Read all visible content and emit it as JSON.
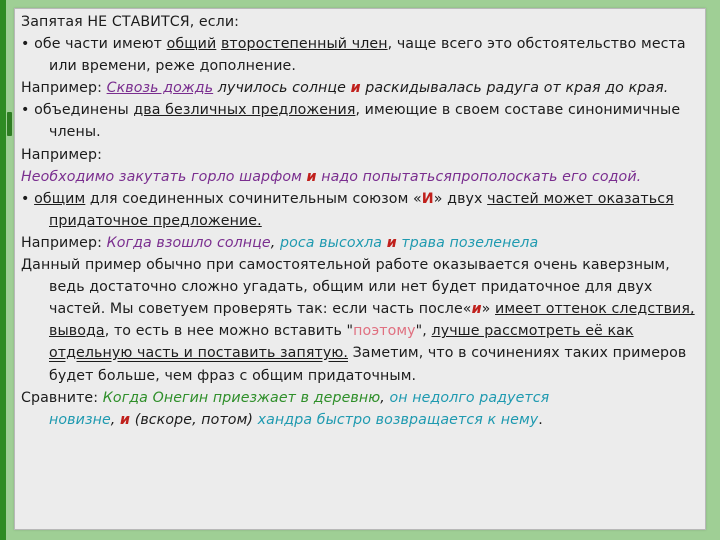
{
  "colors": {
    "frame": "#9fcf95",
    "panel": "#ececec",
    "purple": "#7a2e8f",
    "teal": "#1f9ab0",
    "green": "#2f8f2a",
    "red": "#c0201c"
  },
  "l1": {
    "a": "Запятая НЕ СТАВИТСЯ",
    "b": ", если:"
  },
  "l2": {
    "a": "• обе части имеют ",
    "b": "общий",
    "c": " ",
    "d": "второстепенный член",
    "e": ", чаще всего это обстоятельство места"
  },
  "l3": {
    "a": "или времени, реже дополнение."
  },
  "l4": {
    "a": "Например: ",
    "b": "Сквозь дождь",
    "c": " лучилось солнце ",
    "d": "и",
    "e": " раскидывалась радуга от края до края."
  },
  "l5": {
    "a": "• объединены ",
    "b": "два безличных предложения",
    "c": ", имеющие в своем составе синонимичные"
  },
  "l6": {
    "a": "члены."
  },
  "l7": {
    "a": "Например:"
  },
  "l8": {
    "a": "Необходимо закутать горло шарфом ",
    "b": "и",
    "c": " надо попытатьсяпрополоскать его содой."
  },
  "l9": {
    "a": "• ",
    "b": "общим",
    "c": " для соединенных сочинительным союзом «",
    "d": "И",
    "e": "» двух ",
    "f": "частей может оказаться"
  },
  "l10": {
    "a": "придаточное предложение."
  },
  "l11": {
    "a": "Например: ",
    "b": "Когда взошло солнце",
    "c": ", ",
    "d": "роса высохла ",
    "e": "и",
    "f": " трава позеленела"
  },
  "l12": {
    "a": "Данный пример обычно при самостоятельной работе оказывается очень каверзным,"
  },
  "l13": {
    "a": "ведь достаточно сложно угадать, общим или нет будет придаточное для двух"
  },
  "l14": {
    "a": "частей. Мы советуем проверять так: если часть после«",
    "b": "и",
    "c": "» ",
    "d": "имеет оттенок следствия,"
  },
  "l15": {
    "a": "вывода",
    "b": ", то есть в нее можно вставить \"",
    "c": "поэтому",
    "d": "\", ",
    "e": "лучше рассмотреть её как"
  },
  "l16": {
    "a": "отдельную часть и поставить запятую.",
    "b": " Заметим, что в сочинениях таких примеров"
  },
  "l17": {
    "a": "будет больше, чем фраз с общим придаточным."
  },
  "l18": {
    "a": "Сравните: ",
    "b": "Когда Онегин приезжает в деревню",
    "c": ", ",
    "d": "он недолго радуется"
  },
  "l19": {
    "a": "новизне",
    "b": ", ",
    "c": "и",
    "d": " (вскоре, потом) ",
    "e": "хандра быстро возвращается к нему",
    "f": "."
  }
}
